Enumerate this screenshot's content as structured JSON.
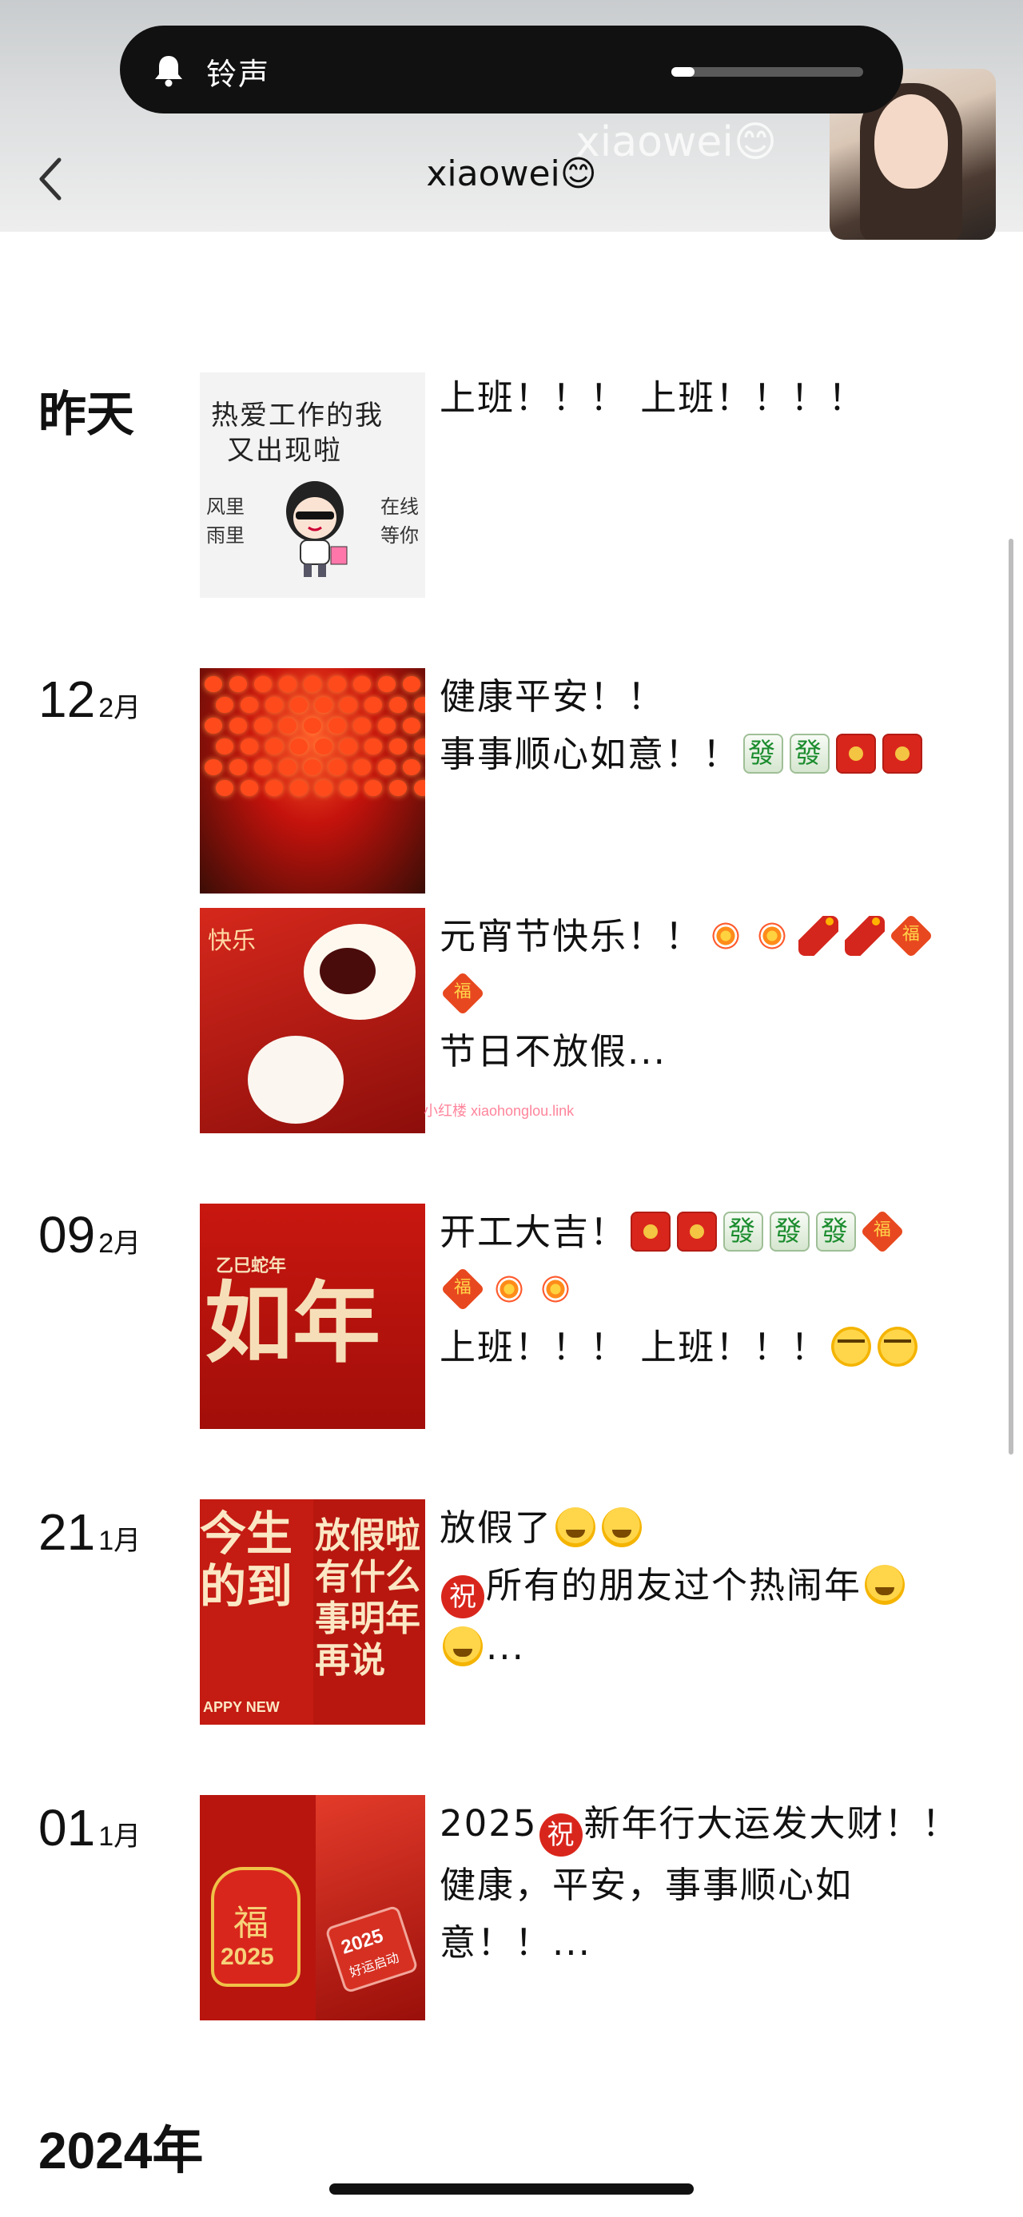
{
  "status": {
    "ringtone_label": "铃声",
    "volume_level": 0.12
  },
  "header": {
    "title": "xiaowei😊",
    "ghost_title": "xiaowei😊"
  },
  "timeline": [
    {
      "date_label": "昨天",
      "posts": [
        {
          "thumb_lines": [
            "热爱工作的我",
            "又出现啦"
          ],
          "thumb_side_left": [
            "风里",
            "雨里"
          ],
          "thumb_side_right": [
            "在线",
            "等你"
          ],
          "text_lines": [
            "上班！！！ 上班！！！！"
          ]
        }
      ]
    },
    {
      "day": "12",
      "month": "2月",
      "posts": [
        {
          "text_lines": [
            "健康平安！！",
            "事事顺心如意！！"
          ]
        },
        {
          "thumb_label": "快乐",
          "text_lines": [
            "元宵节快乐！！",
            "",
            "节日不放假..."
          ]
        }
      ]
    },
    {
      "day": "09",
      "month": "2月",
      "posts": [
        {
          "thumb_small": "乙巳蛇年",
          "thumb_big": "如年",
          "text_lines": [
            "开工大吉！",
            "",
            "上班！！！ 上班！！！"
          ]
        }
      ]
    },
    {
      "day": "21",
      "month": "1月",
      "posts": [
        {
          "thumb_left": "今生的到",
          "thumb_right": "放假啦有什么事明年再说",
          "thumb_footer": "APPY NEW",
          "text_lines": [
            "放假了",
            "所有的朋友过个热闹年",
            "..."
          ]
        }
      ]
    },
    {
      "day": "01",
      "month": "1月",
      "posts": [
        {
          "thumb_bag": "福",
          "thumb_year": "2025",
          "thumb_key": "2025",
          "thumb_key_sub": "好运启动",
          "text_lines": [
            "2025",
            "新年行大运发大财！！",
            "健康，平安，事事顺心如",
            "意！！..."
          ]
        }
      ]
    }
  ],
  "year_section": "2024年",
  "zhu_char": "祝",
  "watermark": "小红楼  xiaohonglou.link",
  "colors": {
    "accent_red": "#d9261c",
    "pill_bg": "#111111"
  }
}
